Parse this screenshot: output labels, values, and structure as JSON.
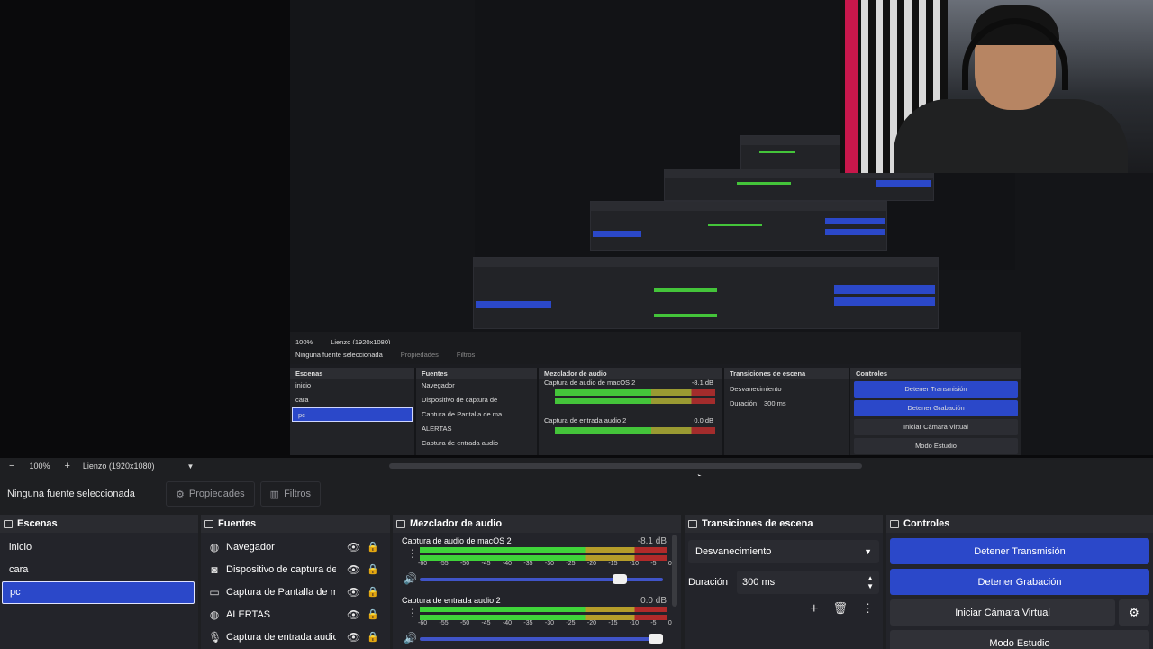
{
  "preview": {
    "inner": {
      "zoom": "100%",
      "canvas": "Lienzo (1920x1080)",
      "no_source": "Ninguna fuente seleccionada",
      "properties": "Propiedades",
      "filters": "Filtros",
      "docks": [
        "Escenas",
        "Fuentes",
        "Mezclador de audio",
        "Transiciones de escena",
        "Controles"
      ],
      "scenes": [
        "inicio",
        "cara",
        "pc"
      ],
      "sources": [
        "Navegador",
        "Dispositivo de captura de",
        "Captura de Pantalla de ma",
        "ALERTAS",
        "Captura de entrada audio"
      ],
      "mixer": [
        {
          "name": "Captura de audio de macOS 2",
          "db": "-8.1 dB"
        },
        {
          "name": "Captura de entrada audio 2",
          "db": "0.0 dB"
        }
      ],
      "transition": "Desvanecimiento",
      "duration_label": "Duración",
      "duration_value": "300 ms",
      "controls": [
        "Detener Transmisión",
        "Detener Grabación",
        "Iniciar Cámara Virtual",
        "Modo Estudio"
      ]
    }
  },
  "statusbar": {
    "zoom_out": "−",
    "zoom": "100%",
    "zoom_in": "+",
    "canvas": "Lienzo (1920x1080)",
    "canvas_arrow": "▼"
  },
  "source_bar": {
    "no_source": "Ninguna fuente seleccionada",
    "properties": "Propiedades",
    "filters": "Filtros"
  },
  "scenes": {
    "title": "Escenas",
    "items": [
      {
        "label": "inicio",
        "active": false
      },
      {
        "label": "cara",
        "active": false
      },
      {
        "label": "pc",
        "active": true
      }
    ]
  },
  "sources": {
    "title": "Fuentes",
    "items": [
      {
        "label": "Navegador",
        "icon": "globe-icon"
      },
      {
        "label": "Dispositivo de captura de",
        "icon": "camera-icon"
      },
      {
        "label": "Captura de Pantalla de ma",
        "icon": "monitor-icon"
      },
      {
        "label": "ALERTAS",
        "icon": "globe-icon"
      },
      {
        "label": "Captura de entrada audio",
        "icon": "microphone-icon"
      }
    ]
  },
  "mixer": {
    "title": "Mezclador de audio",
    "scale": [
      "-60",
      "-55",
      "-50",
      "-45",
      "-40",
      "-35",
      "-30",
      "-25",
      "-20",
      "-15",
      "-10",
      "-5",
      "0"
    ],
    "channels": [
      {
        "name": "Captura de audio de macOS 2",
        "db": "-8.1 dB",
        "volume": 0.85
      },
      {
        "name": "Captura de entrada audio 2",
        "db": "0.0 dB",
        "volume": 1.0
      }
    ]
  },
  "transitions": {
    "title": "Transiciones de escena",
    "selected": "Desvanecimiento",
    "duration_label": "Duración",
    "duration_value": "300 ms"
  },
  "controls": {
    "title": "Controles",
    "stop_stream": "Detener Transmisión",
    "stop_record": "Detener Grabación",
    "virtual_cam": "Iniciar Cámara Virtual",
    "studio_mode": "Modo Estudio"
  },
  "colors": {
    "accent": "#2b48c9",
    "panel": "#23242a",
    "meter_green": "#3fd43a",
    "meter_yellow": "#b59d2a",
    "meter_red": "#b12a2a"
  }
}
